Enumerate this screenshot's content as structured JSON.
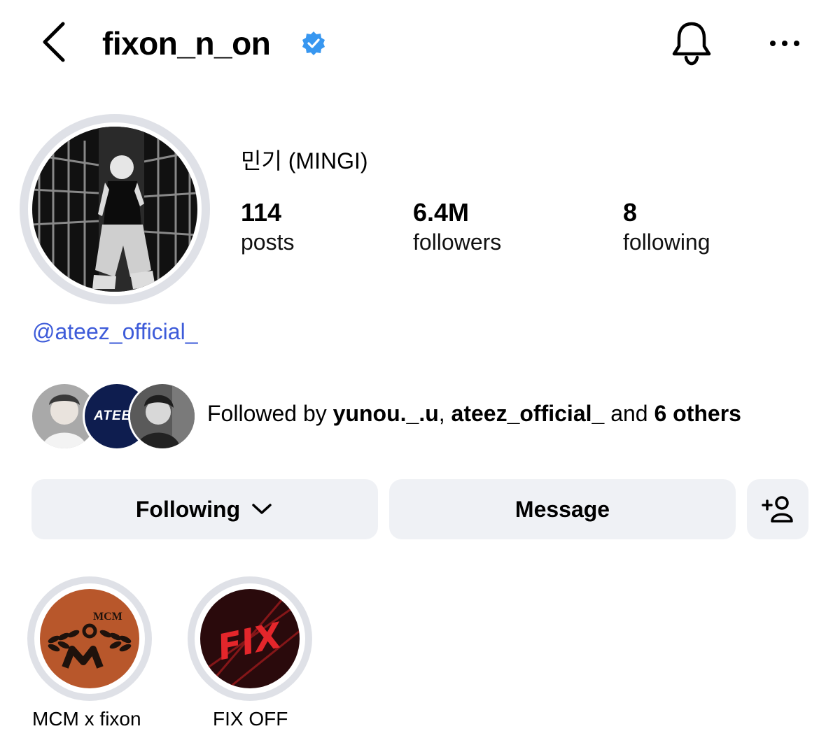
{
  "header": {
    "username": "fixon_n_on",
    "verified": true,
    "back_icon": "chevron-left-icon",
    "bell_icon": "bell-icon",
    "more_icon": "more-horizontal-icon"
  },
  "profile": {
    "display_name": "민기 (MINGI)",
    "link": "@ateez_official_",
    "stats": {
      "posts": {
        "value": "114",
        "label": "posts"
      },
      "followers": {
        "value": "6.4M",
        "label": "followers"
      },
      "following": {
        "value": "8",
        "label": "following"
      }
    }
  },
  "followed_by": {
    "prefix": "Followed by ",
    "user1": "yunou._.u",
    "sep": ", ",
    "user2": "ateez_official_",
    "mid": " and ",
    "others": "6 others",
    "avatar2_text": "ATEEZ"
  },
  "actions": {
    "following_label": "Following",
    "message_label": "Message",
    "add_icon": "add-person-icon"
  },
  "highlights": [
    {
      "label": "MCM x fixon",
      "logo_text": "MCM"
    },
    {
      "label": "FIX OFF",
      "logo_text": "FIX"
    }
  ],
  "colors": {
    "verified_blue": "#3897f0",
    "link_blue": "#3d5bd9",
    "button_bg": "#eff1f5",
    "ring_gray": "#dfe1e7"
  }
}
